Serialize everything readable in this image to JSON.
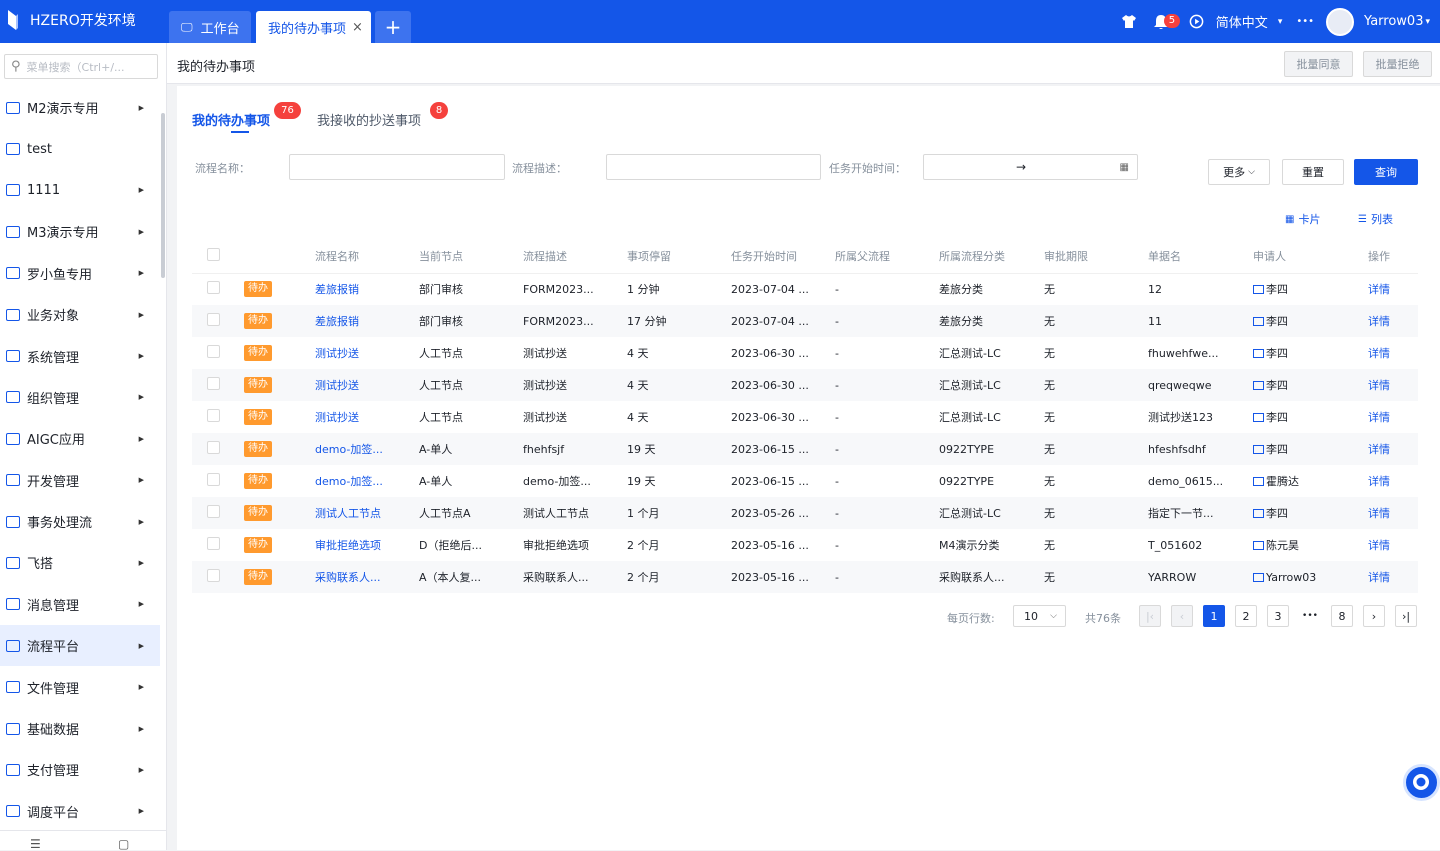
{
  "topbar": {
    "app_title": "HZERO开发环境",
    "tabs": [
      {
        "label": "工作台"
      },
      {
        "label": "我的待办事项",
        "close": "×"
      },
      {
        "label": "+"
      }
    ],
    "notification_count": "5",
    "language": "简体中文",
    "more": "•••",
    "username": "Yarrow03"
  },
  "sidebar": {
    "search_placeholder": "菜单搜索（Ctrl+/...",
    "items": [
      {
        "label": "M2演示专用",
        "has_arrow": true
      },
      {
        "label": "test",
        "has_arrow": false
      },
      {
        "label": "1111",
        "has_arrow": true
      },
      {
        "label": "M3演示专用",
        "has_arrow": true
      },
      {
        "label": "罗小鱼专用",
        "has_arrow": true
      },
      {
        "label": "业务对象",
        "has_arrow": true
      },
      {
        "label": "系统管理",
        "has_arrow": true
      },
      {
        "label": "组织管理",
        "has_arrow": true
      },
      {
        "label": "AIGC应用",
        "has_arrow": true
      },
      {
        "label": "开发管理",
        "has_arrow": true
      },
      {
        "label": "事务处理流",
        "has_arrow": true
      },
      {
        "label": "飞搭",
        "has_arrow": true
      },
      {
        "label": "消息管理",
        "has_arrow": true
      },
      {
        "label": "流程平台",
        "has_arrow": true,
        "active": true
      },
      {
        "label": "文件管理",
        "has_arrow": true
      },
      {
        "label": "基础数据",
        "has_arrow": true
      },
      {
        "label": "支付管理",
        "has_arrow": true
      },
      {
        "label": "调度平台",
        "has_arrow": true
      }
    ]
  },
  "header": {
    "breadcrumb": "我的待办事项",
    "batch_approve": "批量同意",
    "batch_reject": "批量拒绝"
  },
  "content": {
    "tabs": [
      {
        "label": "我的待办事项",
        "count": "76"
      },
      {
        "label": "我接收的抄送事项",
        "count": "8"
      }
    ],
    "filters": {
      "name_label": "流程名称：",
      "desc_label": "流程描述：",
      "start_label": "任务开始时间：",
      "range_sep": "→"
    },
    "buttons": {
      "more": "更多",
      "reset": "重置",
      "query": "查询"
    },
    "views": {
      "card": "卡片",
      "list": "列表"
    },
    "table": {
      "headers": [
        "",
        "",
        "流程名称",
        "当前节点",
        "流程描述",
        "事项停留",
        "任务开始时间",
        "所属父流程",
        "所属流程分类",
        "审批期限",
        "单据名",
        "申请人",
        "操作"
      ],
      "rows": [
        {
          "tag": "待办",
          "name": "差旅报销",
          "node": "部门审核",
          "desc": "FORM2023...",
          "stay": "1 分钟",
          "start": "2023-07-04 ...",
          "parent": "-",
          "category": "差旅分类",
          "deadline": "无",
          "doc": "12",
          "applicant": "李四",
          "action": "详情"
        },
        {
          "tag": "待办",
          "name": "差旅报销",
          "node": "部门审核",
          "desc": "FORM2023...",
          "stay": "17 分钟",
          "start": "2023-07-04 ...",
          "parent": "-",
          "category": "差旅分类",
          "deadline": "无",
          "doc": "11",
          "applicant": "李四",
          "action": "详情"
        },
        {
          "tag": "待办",
          "name": "测试抄送",
          "node": "人工节点",
          "desc": "测试抄送",
          "stay": "4 天",
          "start": "2023-06-30 ...",
          "parent": "-",
          "category": "汇总测试-LC",
          "deadline": "无",
          "doc": "fhuwehfwe...",
          "applicant": "李四",
          "action": "详情"
        },
        {
          "tag": "待办",
          "name": "测试抄送",
          "node": "人工节点",
          "desc": "测试抄送",
          "stay": "4 天",
          "start": "2023-06-30 ...",
          "parent": "-",
          "category": "汇总测试-LC",
          "deadline": "无",
          "doc": "qreqweqwe",
          "applicant": "李四",
          "action": "详情"
        },
        {
          "tag": "待办",
          "name": "测试抄送",
          "node": "人工节点",
          "desc": "测试抄送",
          "stay": "4 天",
          "start": "2023-06-30 ...",
          "parent": "-",
          "category": "汇总测试-LC",
          "deadline": "无",
          "doc": "测试抄送123",
          "applicant": "李四",
          "action": "详情"
        },
        {
          "tag": "待办",
          "name": "demo-加签...",
          "node": "A-单人",
          "desc": "fhehfsjf",
          "stay": "19 天",
          "start": "2023-06-15 ...",
          "parent": "-",
          "category": "0922TYPE",
          "deadline": "无",
          "doc": "hfeshfsdhf",
          "applicant": "李四",
          "action": "详情"
        },
        {
          "tag": "待办",
          "name": "demo-加签...",
          "node": "A-单人",
          "desc": "demo-加签...",
          "stay": "19 天",
          "start": "2023-06-15 ...",
          "parent": "-",
          "category": "0922TYPE",
          "deadline": "无",
          "doc": "demo_0615...",
          "applicant": "霍腾达",
          "action": "详情"
        },
        {
          "tag": "待办",
          "name": "测试人工节点",
          "node": "人工节点A",
          "desc": "测试人工节点",
          "stay": "1 个月",
          "start": "2023-05-26 ...",
          "parent": "-",
          "category": "汇总测试-LC",
          "deadline": "无",
          "doc": "指定下一节...",
          "applicant": "李四",
          "action": "详情"
        },
        {
          "tag": "待办",
          "name": "审批拒绝选项",
          "node": "D（拒绝后...",
          "desc": "审批拒绝选项",
          "stay": "2 个月",
          "start": "2023-05-16 ...",
          "parent": "-",
          "category": "M4演示分类",
          "deadline": "无",
          "doc": "T_051602",
          "applicant": "陈元昊",
          "action": "详情"
        },
        {
          "tag": "待办",
          "name": "采购联系人...",
          "node": "A（本人复...",
          "desc": "采购联系人...",
          "stay": "2 个月",
          "start": "2023-05-16 ...",
          "parent": "-",
          "category": "采购联系人...",
          "deadline": "无",
          "doc": "YARROW",
          "applicant": "Yarrow03",
          "action": "详情"
        }
      ]
    },
    "pagination": {
      "page_size_label": "每页行数:",
      "page_size": "10",
      "total": "共76条",
      "pages": [
        "1",
        "2",
        "3",
        "•••",
        "8"
      ],
      "current": "1"
    }
  }
}
